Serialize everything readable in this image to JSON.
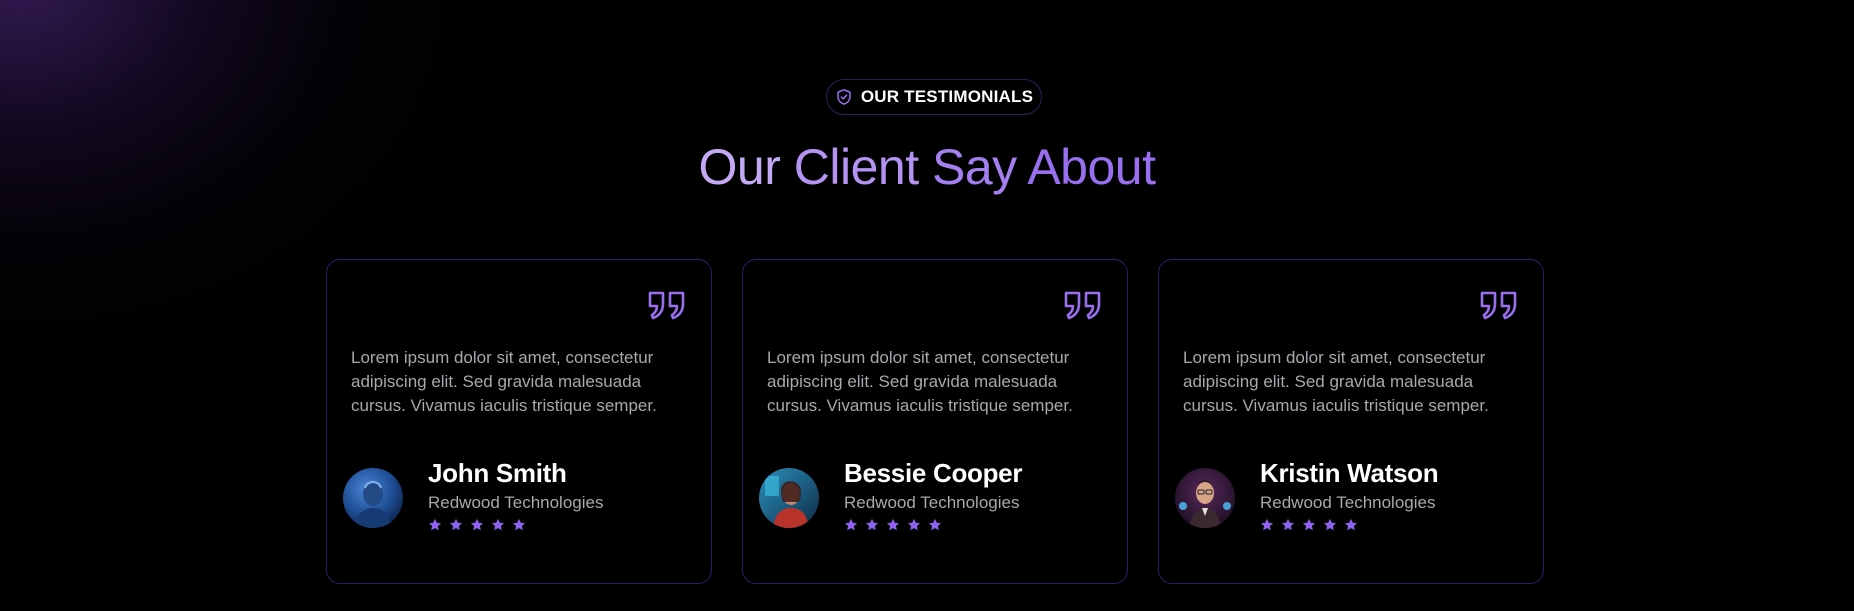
{
  "badge": {
    "icon": "shield-check-icon",
    "label": "OUR TESTIMONIALS"
  },
  "heading": {
    "words": [
      "Our",
      "Client",
      "Say",
      "About"
    ]
  },
  "colors": {
    "accent": "#9a6ef0",
    "card_border": "#2a1f66",
    "muted_text": "#a8a8ad",
    "star": "#8f63f0"
  },
  "testimonials": [
    {
      "quote": "Lorem ipsum dolor sit amet, consectetur adipiscing elit. Sed gravida malesuada cursus. Vivamus iaculis tristique semper.",
      "name": "John Smith",
      "company": "Redwood Technologies",
      "rating": 5,
      "quote_icon": "quote-icon",
      "star_icon": "star-icon"
    },
    {
      "quote": "Lorem ipsum dolor sit amet, consectetur adipiscing elit. Sed gravida malesuada cursus. Vivamus iaculis tristique semper.",
      "name": "Bessie Cooper",
      "company": "Redwood Technologies",
      "rating": 5,
      "quote_icon": "quote-icon",
      "star_icon": "star-icon"
    },
    {
      "quote": "Lorem ipsum dolor sit amet, consectetur adipiscing elit. Sed gravida malesuada cursus. Vivamus iaculis tristique semper.",
      "name": "Kristin Watson",
      "company": "Redwood Technologies",
      "rating": 5,
      "quote_icon": "quote-icon",
      "star_icon": "star-icon"
    }
  ]
}
